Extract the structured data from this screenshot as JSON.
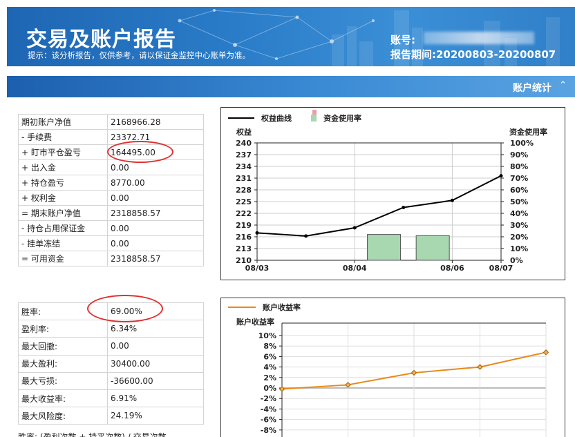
{
  "header": {
    "title": "交易及账户报告",
    "hint": "提示：该分析报告，仅供参考，请以保证金监控中心账单为准。",
    "account_label": "账号:",
    "period_label": "报告期间:",
    "period_value": "20200803-20200807"
  },
  "section": {
    "label": "账户统计",
    "toggle_icon": "double-chevron-up-icon"
  },
  "account_table": [
    {
      "k": "期初账户净值",
      "v": "2168966.28"
    },
    {
      "k": "- 手续费",
      "v": "23372.71"
    },
    {
      "k": "+ 盯市平仓盈亏",
      "v": "164495.00"
    },
    {
      "k": "+ 出入金",
      "v": "0.00"
    },
    {
      "k": "+ 持仓盈亏",
      "v": "8770.00"
    },
    {
      "k": "+ 权利金",
      "v": "0.00"
    },
    {
      "k": "= 期末账户净值",
      "v": "2318858.57"
    },
    {
      "k": "- 持仓占用保证金",
      "v": "0.00"
    },
    {
      "k": "- 挂单冻结",
      "v": "0.00"
    },
    {
      "k": "= 可用资金",
      "v": "2318858.57"
    }
  ],
  "perf_table": [
    {
      "k": "胜率:",
      "v": "69.00%"
    },
    {
      "k": "盈利率:",
      "v": "6.34%"
    },
    {
      "k": "最大回撤:",
      "v": "0.00"
    },
    {
      "k": "最大盈利:",
      "v": "30400.00"
    },
    {
      "k": "最大亏损:",
      "v": "-36600.00"
    },
    {
      "k": "最大收益率:",
      "v": "6.91%"
    },
    {
      "k": "最大风险度:",
      "v": "24.19%"
    }
  ],
  "footnote": "胜率: (盈利次数 + 持平次数) / 交易次数",
  "colors": {
    "banner": "#2a7cc8",
    "section_bar": "#3a8ad4",
    "equity_line": "#000000",
    "margin_bar": "#a8d8b0",
    "return_line": "#e88a1a",
    "highlight": "#e03030"
  },
  "chart_data": [
    {
      "type": "line",
      "legend": [
        "权益曲线",
        "资金使用率"
      ],
      "ylabel": "权益",
      "y2label": "资金使用率",
      "yticks": [
        "240",
        "237",
        "234",
        "231",
        "228",
        "225",
        "222",
        "219",
        "216",
        "213",
        "210"
      ],
      "y2ticks": [
        "100%",
        "90%",
        "80%",
        "70%",
        "60%",
        "50%",
        "40%",
        "30%",
        "20%",
        "10%",
        "0%"
      ],
      "xticks": [
        "08/03",
        "08/04",
        "08/06",
        "08/07"
      ],
      "ylim": [
        210,
        240
      ],
      "y2lim": [
        0,
        100
      ],
      "equity_series": {
        "name": "权益曲线",
        "values": [
          217,
          216.2,
          218.3,
          223.5,
          225.3,
          231.6
        ]
      },
      "margin_series": {
        "name": "资金使用率",
        "bars": [
          {
            "slot": 2.6,
            "value": 22
          },
          {
            "slot": 3.6,
            "value": 21
          }
        ]
      }
    },
    {
      "type": "line",
      "legend": [
        "账户收益率"
      ],
      "ylabel": "账户收益率",
      "yticks": [
        "10%",
        "8%",
        "6%",
        "4%",
        "2%",
        "0%",
        "-2%",
        "-4%",
        "-6%",
        "-8%",
        "-10%"
      ],
      "ylim": [
        -10,
        10
      ],
      "series": [
        {
          "name": "账户收益率",
          "values": [
            -0.2,
            0.6,
            2.9,
            4.0,
            6.8
          ]
        }
      ]
    }
  ]
}
